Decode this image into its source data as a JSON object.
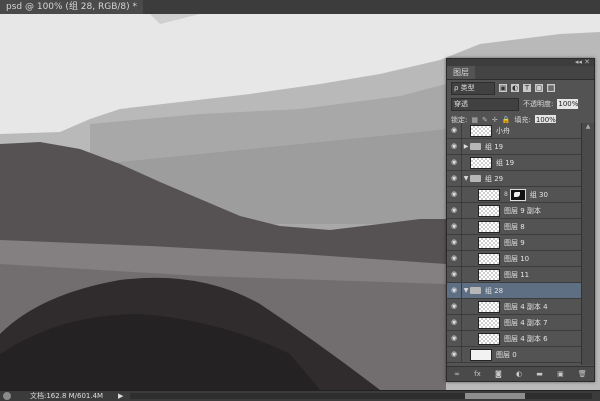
{
  "document": {
    "tab_title": "psd @ 100% (组 28, RGB/8) *"
  },
  "panel": {
    "tab": "图层",
    "filter": {
      "kind_label": "ρ 类型",
      "icons": [
        "image-filter-icon",
        "adjustment-filter-icon",
        "type-filter-icon",
        "shape-filter-icon",
        "smart-filter-icon"
      ]
    },
    "blend_mode": "穿透",
    "opacity_label": "不透明度:",
    "opacity_value": "100%",
    "lock_label": "锁定:",
    "fill_label": "填充:",
    "fill_value": "100%",
    "layers": [
      {
        "name": "小舟"
      },
      {
        "name": "组 19"
      },
      {
        "name": "组 19"
      },
      {
        "name": "组 29"
      },
      {
        "name": "组 30"
      },
      {
        "name": "图层 9 副本"
      },
      {
        "name": "图层 8"
      },
      {
        "name": "图层 9"
      },
      {
        "name": "图层 10"
      },
      {
        "name": "图层 11"
      },
      {
        "name": "组 28"
      },
      {
        "name": "图层 4 副本 4"
      },
      {
        "name": "图层 4 副本 7"
      },
      {
        "name": "图层 4 副本 6"
      },
      {
        "name": "图层 0"
      }
    ],
    "footer_icons": [
      "link-icon",
      "fx-icon",
      "mask-icon",
      "adjustment-icon",
      "new-group-icon",
      "new-layer-icon",
      "trash-icon"
    ]
  },
  "status": {
    "doc_info": "文档:162.8 M/601.4M"
  },
  "colors": {
    "selected_row": "#5e6f84",
    "panel_bg": "#535353"
  }
}
